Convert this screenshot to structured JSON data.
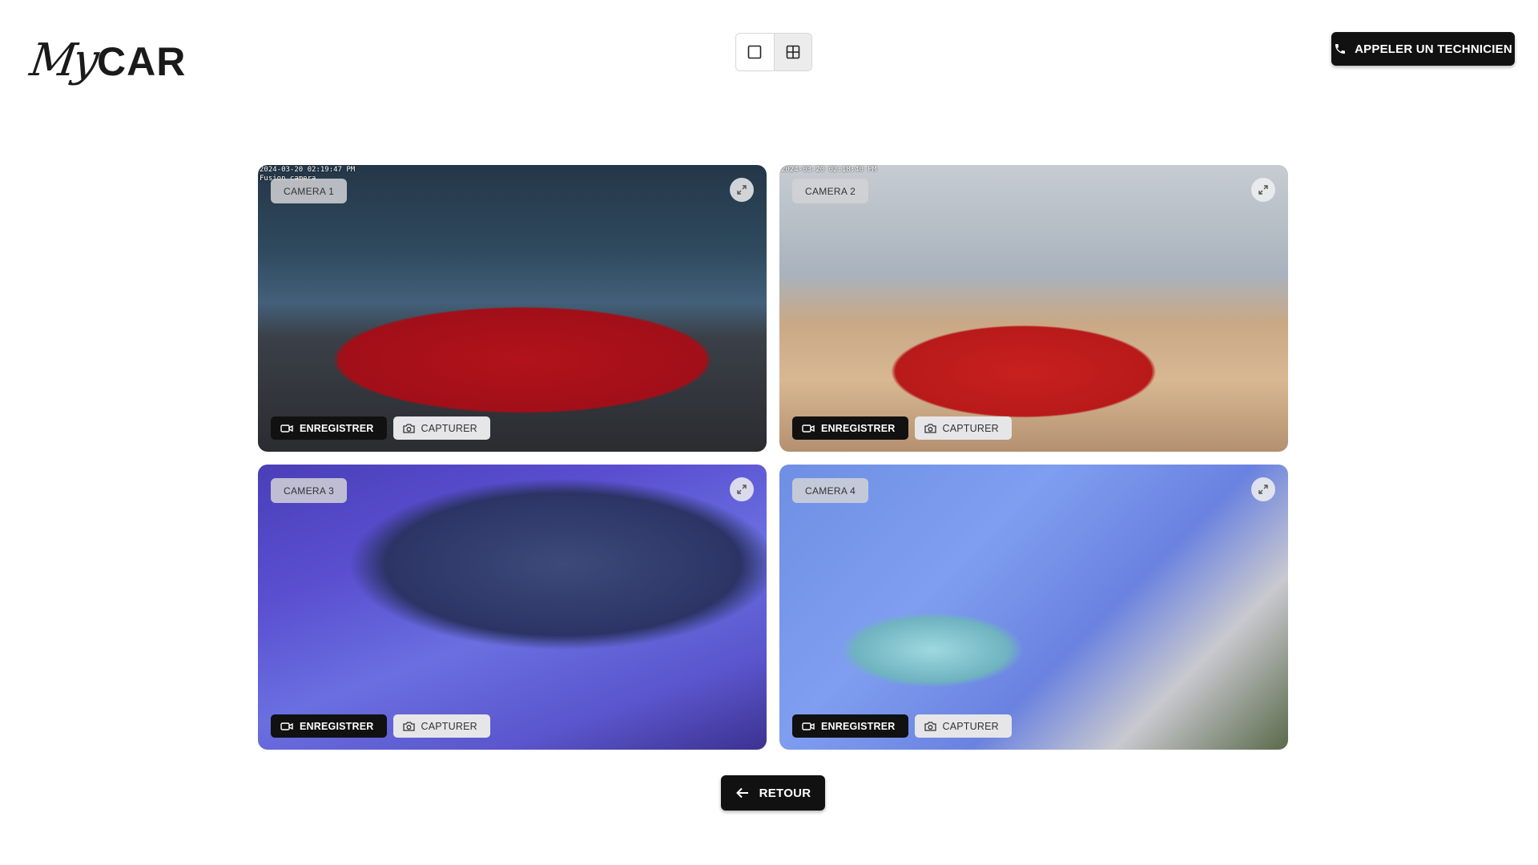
{
  "brand": {
    "logo_my": "My",
    "logo_car": "CAR"
  },
  "header": {
    "view_toggle": {
      "single_icon": "square-icon",
      "grid_icon": "grid-2x2-icon",
      "active": "grid"
    },
    "call_button": {
      "label": "APPELER UN TECHNICIEN",
      "icon": "phone-icon"
    }
  },
  "cameras": [
    {
      "label": "CAMERA 1",
      "timestamp": "2024-03-20 02:19:47 PM",
      "timestamp_sub": "Fusion camera",
      "record_label": "ENREGISTRER",
      "capture_label": "CAPTURER"
    },
    {
      "label": "CAMERA 2",
      "timestamp": "2024-03-20 02:18:40 PM",
      "record_label": "ENREGISTRER",
      "capture_label": "CAPTURER"
    },
    {
      "label": "CAMERA 3",
      "record_label": "ENREGISTRER",
      "capture_label": "CAPTURER"
    },
    {
      "label": "CAMERA 4",
      "record_label": "ENREGISTRER",
      "capture_label": "CAPTURER"
    }
  ],
  "footer": {
    "back_label": "RETOUR",
    "back_icon": "arrow-left-icon"
  },
  "colors": {
    "primary": "#111111",
    "secondary_button": "#e6e6e8",
    "label_chip": "#d2d2d6"
  }
}
